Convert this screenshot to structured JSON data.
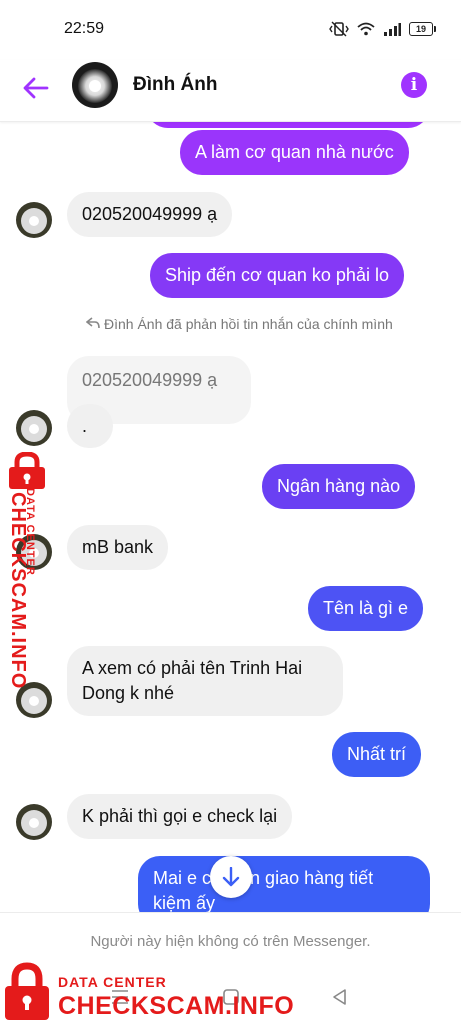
{
  "status_bar": {
    "time": "22:59",
    "battery": "19"
  },
  "header": {
    "contact_name": "Đình Ánh"
  },
  "messages": [
    {
      "text": "A làm cơ quan nhà nước"
    },
    {
      "text": "020520049999 ạ"
    },
    {
      "text": "Ship đến cơ quan ko phải lo"
    },
    {
      "reply_note": "Đình Ánh đã phản hồi tin nhắn của chính mình"
    },
    {
      "quoted": "020520049999 ạ",
      "text": "."
    },
    {
      "text": "Ngân hàng nào"
    },
    {
      "text": "mB bank"
    },
    {
      "text": "Tên là gì e"
    },
    {
      "text": "A xem có phải tên Trinh Hai Dong k nhé"
    },
    {
      "text": "Nhất trí"
    },
    {
      "text": "K phải thì gọi e check lại"
    },
    {
      "text": "Mai e chuyển giao hàng tiết kiệm ấy"
    }
  ],
  "footer": {
    "notice": "Người này hiện không có trên Messenger."
  },
  "watermark": {
    "label_small": "DATA CENTER",
    "label_big": "CHECKSCAM.INFO"
  },
  "colors": {
    "purple": "#a033ff",
    "violet": "#7a3cf2",
    "blue": "#3b5ff6",
    "incoming": "#f0f0f0",
    "watermark_red": "#e41b1b"
  },
  "icons": {
    "back": "arrow-left-icon",
    "info": "info-icon",
    "scroll": "arrow-down-icon",
    "reply": "reply-icon",
    "lock": "lock-icon"
  }
}
